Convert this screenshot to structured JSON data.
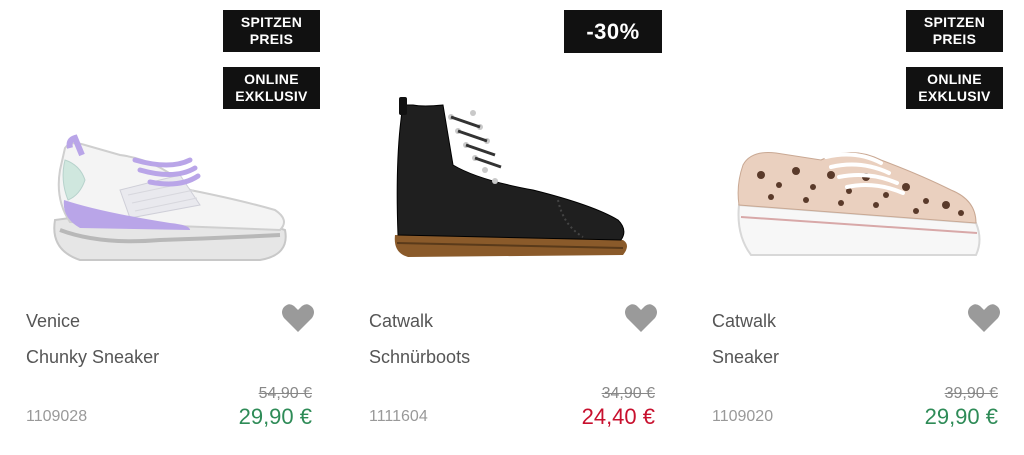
{
  "products": [
    {
      "badges": [
        "SPITZEN PREIS",
        "ONLINE EXKLUSIV"
      ],
      "badge_lines": [
        [
          "SPITZEN",
          "PREIS"
        ],
        [
          "ONLINE",
          "EXKLUSIV"
        ]
      ],
      "brand": "Venice",
      "name": "Chunky Sneaker",
      "article": "1109028",
      "old_price": "54,90 €",
      "new_price": "29,90 €",
      "price_color": "#2e8b57",
      "image": "white-lilac-chunky-sneaker"
    },
    {
      "badges": [
        "-30%"
      ],
      "brand": "Catwalk",
      "name": "Schnürboots",
      "article": "1111604",
      "old_price": "34,90 €",
      "new_price": "24,40 €",
      "price_color": "#c8102e",
      "image": "black-lace-up-boot"
    },
    {
      "badges": [
        "SPITZEN PREIS",
        "ONLINE EXKLUSIV"
      ],
      "badge_lines": [
        [
          "SPITZEN",
          "PREIS"
        ],
        [
          "ONLINE",
          "EXKLUSIV"
        ]
      ],
      "brand": "Catwalk",
      "name": "Sneaker",
      "article": "1109020",
      "old_price": "39,90 €",
      "new_price": "29,90 €",
      "price_color": "#2e8b57",
      "image": "leopard-print-platform-sneaker"
    }
  ],
  "icons": {
    "wishlist": "heart-icon"
  },
  "colors": {
    "badge_bg": "#111111",
    "heart": "#9a9a9a"
  }
}
